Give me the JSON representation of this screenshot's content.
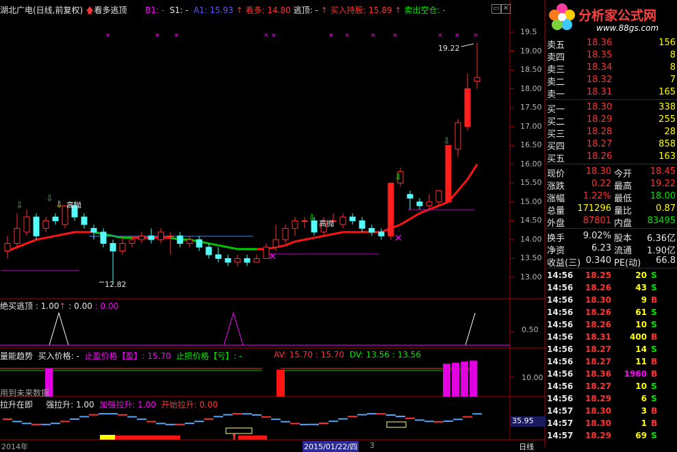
{
  "main_header": {
    "title": "湖北广电(日线,前复权)",
    "indicator": "看多逃顶",
    "b1": "B1: -",
    "s1": "S1: -",
    "a1": "A1: 15.93",
    "kanduo": "看多: 14.80",
    "taoding": "逃顶: -",
    "mairu": "买入持股: 15.89",
    "maichu": "卖出空仓: -"
  },
  "price_axis": [
    "19.5",
    "19.00",
    "18.50",
    "18.00",
    "17.50",
    "17.00",
    "16.50",
    "16.00",
    "15.50",
    "15.00",
    "14.50",
    "14.00",
    "13.50",
    "13.00"
  ],
  "annotations": {
    "high": "19.22",
    "low": "12.82",
    "gaopao1": "高抛",
    "gaopao2": "高抛"
  },
  "pane2": {
    "title": "绝买逃顶 : 1.00",
    "v2": ": 0.00",
    "v3": ": 0.00",
    "axis": "0.50"
  },
  "pane3": {
    "title": "量能趋势",
    "buy": "买入价格: -",
    "stop_profit": "止盈价格【盈】: 15.70",
    "stop_loss": "止损价格【亏】: -",
    "av": "AV: 15.70 : 15.70",
    "dv": "DV: 13.56 : 13.56",
    "future": "用到未来数据",
    "axis": "10.00"
  },
  "pane4": {
    "title": "拉升在即",
    "qiang": "强拉升: 1.00",
    "jiaqiang": "加强拉升: 1.00",
    "kaishi": "开始拉升: 0.00",
    "axis_box": "35.95"
  },
  "bottom": {
    "date_left": "2014年",
    "date_mid": "2015/01/22/四",
    "mark": "3",
    "period": "日线"
  },
  "logo": {
    "text": "分析家公式网",
    "url": "www.88gs.com"
  },
  "quotes": {
    "asks": [
      {
        "label": "卖五",
        "price": "18.36",
        "vol": "156"
      },
      {
        "label": "卖四",
        "price": "18.35",
        "vol": "8"
      },
      {
        "label": "卖三",
        "price": "18.34",
        "vol": "8"
      },
      {
        "label": "卖二",
        "price": "18.32",
        "vol": "7"
      },
      {
        "label": "卖一",
        "price": "18.31",
        "vol": "165"
      }
    ],
    "bids": [
      {
        "label": "买一",
        "price": "18.30",
        "vol": "338"
      },
      {
        "label": "买二",
        "price": "18.29",
        "vol": "255"
      },
      {
        "label": "买三",
        "price": "18.28",
        "vol": "28"
      },
      {
        "label": "买四",
        "price": "18.27",
        "vol": "858"
      },
      {
        "label": "买五",
        "price": "18.26",
        "vol": "163"
      }
    ],
    "stats": [
      {
        "l1": "现价",
        "v1": "18.30",
        "l2": "今开",
        "v2": "18.45"
      },
      {
        "l1": "涨跌",
        "v1": "0.22",
        "l2": "最高",
        "v2": "19.22"
      },
      {
        "l1": "涨幅",
        "v1": "1.22%",
        "l2": "最低",
        "v2": "18.00"
      },
      {
        "l1": "总量",
        "v1": "171296",
        "l2": "量比",
        "v2": "0.87"
      },
      {
        "l1": "外盘",
        "v1": "87801",
        "l2": "内盘",
        "v2": "83495"
      }
    ],
    "stats2": [
      {
        "l1": "换手",
        "v1": "9.02%",
        "l2": "股本",
        "v2": "6.36亿"
      },
      {
        "l1": "净资",
        "v1": "6.23",
        "l2": "流通",
        "v2": "1.90亿"
      },
      {
        "l1": "收益(三)",
        "v1": "0.340",
        "l2": "PE(动)",
        "v2": "66.8"
      }
    ],
    "ticks": [
      {
        "t": "14:56",
        "p": "18.25",
        "v": "20",
        "s": "S"
      },
      {
        "t": "14:56",
        "p": "18.26",
        "v": "43",
        "s": "S"
      },
      {
        "t": "14:56",
        "p": "18.30",
        "v": "9",
        "s": "B"
      },
      {
        "t": "14:56",
        "p": "18.26",
        "v": "61",
        "s": "S"
      },
      {
        "t": "14:56",
        "p": "18.26",
        "v": "10",
        "s": "S"
      },
      {
        "t": "14:56",
        "p": "18.31",
        "v": "400",
        "s": "B"
      },
      {
        "t": "14:56",
        "p": "18.27",
        "v": "14",
        "s": "S"
      },
      {
        "t": "14:56",
        "p": "18.27",
        "v": "11",
        "s": "B"
      },
      {
        "t": "14:56",
        "p": "18.36",
        "v": "1960",
        "s": "B"
      },
      {
        "t": "14:56",
        "p": "18.27",
        "v": "10",
        "s": "S"
      },
      {
        "t": "14:56",
        "p": "18.29",
        "v": "6",
        "s": "S"
      },
      {
        "t": "14:57",
        "p": "18.30",
        "v": "3",
        "s": "B"
      },
      {
        "t": "14:57",
        "p": "18.30",
        "v": "1",
        "s": "B"
      },
      {
        "t": "14:57",
        "p": "18.29",
        "v": "69",
        "s": "S"
      }
    ]
  },
  "chart_data": {
    "type": "candlestick",
    "candles": [
      {
        "o": 13.7,
        "c": 13.9,
        "h": 14.1,
        "l": 13.5
      },
      {
        "o": 13.9,
        "c": 14.3,
        "h": 14.7,
        "l": 13.8
      },
      {
        "o": 14.2,
        "c": 14.6,
        "h": 14.8,
        "l": 14.1
      },
      {
        "o": 14.6,
        "c": 14.1,
        "h": 14.7,
        "l": 14.0
      },
      {
        "o": 14.3,
        "c": 14.5,
        "h": 14.6,
        "l": 14.2
      },
      {
        "o": 14.6,
        "c": 14.5,
        "h": 14.7,
        "l": 14.4
      },
      {
        "o": 14.4,
        "c": 14.9,
        "h": 14.9,
        "l": 14.3
      },
      {
        "o": 14.9,
        "c": 14.6,
        "h": 15.0,
        "l": 14.5
      },
      {
        "o": 14.6,
        "c": 14.4,
        "h": 14.7,
        "l": 14.3
      },
      {
        "o": 14.3,
        "c": 14.2,
        "h": 14.4,
        "l": 14.0
      },
      {
        "o": 14.2,
        "c": 13.9,
        "h": 14.3,
        "l": 13.8
      },
      {
        "o": 13.9,
        "c": 13.7,
        "h": 14.0,
        "l": 12.82
      },
      {
        "o": 13.7,
        "c": 13.9,
        "h": 14.1,
        "l": 13.6
      },
      {
        "o": 13.9,
        "c": 14.0,
        "h": 14.1,
        "l": 13.8
      },
      {
        "o": 14.0,
        "c": 14.1,
        "h": 14.2,
        "l": 13.9
      },
      {
        "o": 14.1,
        "c": 14.0,
        "h": 14.3,
        "l": 13.9
      },
      {
        "o": 14.0,
        "c": 14.2,
        "h": 14.3,
        "l": 13.9
      },
      {
        "o": 14.1,
        "c": 14.1,
        "h": 14.2,
        "l": 13.6
      },
      {
        "o": 14.1,
        "c": 13.9,
        "h": 14.2,
        "l": 13.8
      },
      {
        "o": 13.9,
        "c": 14.0,
        "h": 14.1,
        "l": 13.8
      },
      {
        "o": 14.0,
        "c": 13.8,
        "h": 14.1,
        "l": 13.7
      },
      {
        "o": 13.8,
        "c": 13.6,
        "h": 13.9,
        "l": 13.5
      },
      {
        "o": 13.6,
        "c": 13.5,
        "h": 13.8,
        "l": 13.4
      },
      {
        "o": 13.5,
        "c": 13.4,
        "h": 13.6,
        "l": 13.3
      },
      {
        "o": 13.4,
        "c": 13.5,
        "h": 13.6,
        "l": 13.3
      },
      {
        "o": 13.5,
        "c": 13.4,
        "h": 13.6,
        "l": 13.3
      },
      {
        "o": 13.4,
        "c": 13.5,
        "h": 13.6,
        "l": 13.4
      },
      {
        "o": 13.5,
        "c": 13.8,
        "h": 13.9,
        "l": 13.5
      },
      {
        "o": 13.8,
        "c": 14.0,
        "h": 14.4,
        "l": 13.7
      },
      {
        "o": 14.0,
        "c": 14.3,
        "h": 14.4,
        "l": 13.9
      },
      {
        "o": 14.3,
        "c": 14.5,
        "h": 14.6,
        "l": 14.1
      },
      {
        "o": 14.5,
        "c": 14.5,
        "h": 14.6,
        "l": 14.3
      },
      {
        "o": 14.5,
        "c": 14.2,
        "h": 14.6,
        "l": 14.1
      },
      {
        "o": 14.2,
        "c": 14.5,
        "h": 14.6,
        "l": 14.1
      },
      {
        "o": 14.5,
        "c": 14.5,
        "h": 14.7,
        "l": 14.4
      },
      {
        "o": 14.4,
        "c": 14.6,
        "h": 14.7,
        "l": 14.3
      },
      {
        "o": 14.6,
        "c": 14.5,
        "h": 14.7,
        "l": 14.4
      },
      {
        "o": 14.5,
        "c": 14.3,
        "h": 14.6,
        "l": 14.2
      },
      {
        "o": 14.3,
        "c": 14.2,
        "h": 14.4,
        "l": 14.1
      },
      {
        "o": 14.2,
        "c": 14.1,
        "h": 14.3,
        "l": 14.0
      },
      {
        "o": 14.1,
        "c": 15.5,
        "h": 15.5,
        "l": 14.0
      },
      {
        "o": 15.5,
        "c": 15.8,
        "h": 15.9,
        "l": 15.4
      },
      {
        "o": 15.2,
        "c": 15.1,
        "h": 15.3,
        "l": 14.8
      },
      {
        "o": 15.0,
        "c": 14.9,
        "h": 15.1,
        "l": 14.8
      },
      {
        "o": 14.9,
        "c": 15.0,
        "h": 15.2,
        "l": 14.8
      },
      {
        "o": 15.0,
        "c": 15.3,
        "h": 15.3,
        "l": 14.9
      },
      {
        "o": 15.0,
        "c": 16.5,
        "h": 16.5,
        "l": 15.0
      },
      {
        "o": 16.4,
        "c": 17.1,
        "h": 17.2,
        "l": 16.2
      },
      {
        "o": 17.0,
        "c": 18.0,
        "h": 18.4,
        "l": 16.9
      },
      {
        "o": 18.2,
        "c": 18.3,
        "h": 19.22,
        "l": 18.0
      }
    ],
    "ma": [
      13.7,
      13.8,
      13.9,
      14.0,
      14.05,
      14.1,
      14.15,
      14.2,
      14.2,
      14.2,
      14.15,
      14.1,
      14.05,
      14.05,
      14.05,
      14.05,
      14.05,
      14.05,
      14.0,
      14.0,
      13.95,
      13.9,
      13.85,
      13.8,
      13.75,
      13.75,
      13.75,
      13.75,
      13.8,
      13.85,
      13.95,
      14.0,
      14.05,
      14.1,
      14.15,
      14.2,
      14.2,
      14.2,
      14.2,
      14.2,
      14.3,
      14.4,
      14.55,
      14.7,
      14.8,
      14.9,
      15.0,
      15.3,
      15.6,
      16.0
    ],
    "ylim": [
      12.7,
      19.6
    ]
  }
}
